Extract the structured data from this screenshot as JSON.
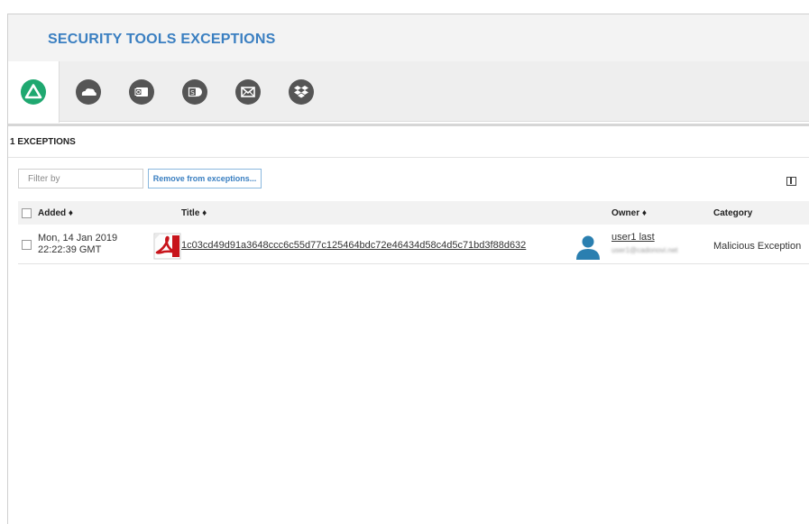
{
  "header": {
    "title": "SECURITY TOOLS EXCEPTIONS"
  },
  "tabs": [
    {
      "icon": "google-drive-icon",
      "color": "#1fa870",
      "active": true
    },
    {
      "icon": "onedrive-icon",
      "color": "#555555",
      "active": false
    },
    {
      "icon": "outlook-icon",
      "color": "#555555",
      "active": false
    },
    {
      "icon": "sharepoint-icon",
      "color": "#555555",
      "active": false
    },
    {
      "icon": "email-icon",
      "color": "#555555",
      "active": false
    },
    {
      "icon": "dropbox-icon",
      "color": "#555555",
      "active": false
    }
  ],
  "exceptions": {
    "count_label": "1 EXCEPTIONS"
  },
  "toolbar": {
    "filter_placeholder": "Filter by",
    "remove_label": "Remove from exceptions..."
  },
  "table": {
    "columns": {
      "added": "Added ♦",
      "title": "Title ♦",
      "owner": "Owner ♦",
      "category": "Category"
    },
    "rows": [
      {
        "added_date": "Mon, 14 Jan 2019",
        "added_time": "22:22:39 GMT",
        "file_icon": "pdf-file-icon",
        "title": "1c03cd49d91a3648ccc6c55d77c125464bdc72e46434d58c4d5c71bd3f88d632",
        "owner_name": "user1 last",
        "owner_email": "user1@cadonovi.net",
        "category": "Malicious Exception"
      }
    ]
  },
  "colors": {
    "accent": "#3a7fc1",
    "active_tab": "#1fa870",
    "inactive_tab": "#555555"
  }
}
